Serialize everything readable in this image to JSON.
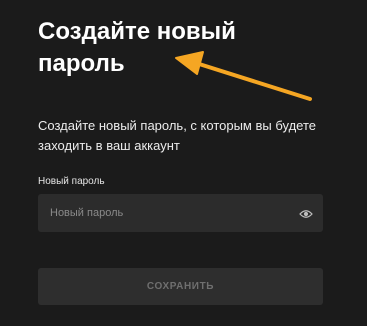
{
  "header": {
    "title": "Создайте новый пароль",
    "subtitle": "Создайте новый пароль, с которым вы будете заходить в ваш аккаунт"
  },
  "password_field": {
    "label": "Новый пароль",
    "placeholder": "Новый пароль",
    "value": "",
    "toggle_icon": "eye-icon"
  },
  "actions": {
    "save_label": "СОХРАНИТЬ"
  },
  "annotation": {
    "arrow_color": "#f5a623"
  },
  "colors": {
    "background": "#1b1b1b",
    "input_background": "#2c2c2c",
    "button_background": "#2e2e2e",
    "button_text": "#6f6f6f"
  }
}
